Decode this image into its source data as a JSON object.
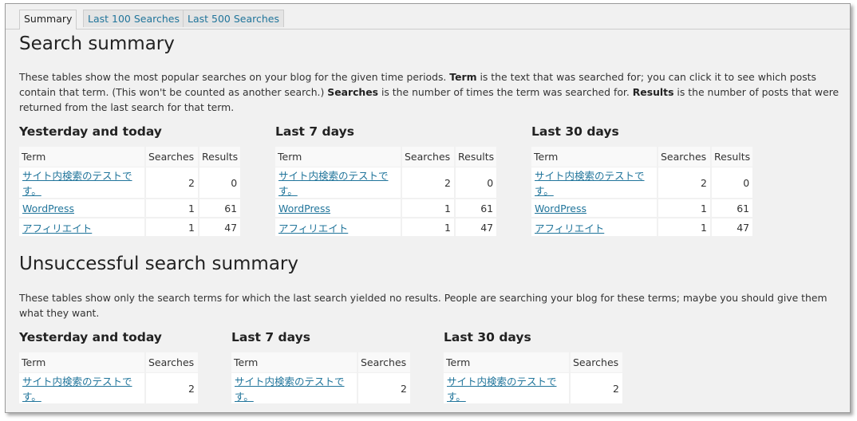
{
  "tabs": [
    "Summary",
    "Last 100 Searches",
    "Last 500 Searches"
  ],
  "summary": {
    "title": "Search summary",
    "desc": {
      "p1": "These tables show the most popular searches on your blog for the given time periods. ",
      "b1": "Term",
      "p2": " is the text that was searched for; you can click it to see which posts contain that term. (This won't be counted as another search.) ",
      "b2": "Searches",
      "p3": " is the number of times the term was searched for. ",
      "b3": "Results",
      "p4": " is the number of posts that were returned from the last search for that term."
    },
    "headers": {
      "term": "Term",
      "searches": "Searches",
      "results": "Results"
    },
    "periods": [
      {
        "title": "Yesterday and today",
        "rows": [
          {
            "term": "サイト内検索のテストです。",
            "searches": "2",
            "results": "0"
          },
          {
            "term": "WordPress",
            "searches": "1",
            "results": "61"
          },
          {
            "term": "アフィリエイト",
            "searches": "1",
            "results": "47"
          }
        ]
      },
      {
        "title": "Last 7 days",
        "rows": [
          {
            "term": "サイト内検索のテストです。",
            "searches": "2",
            "results": "0"
          },
          {
            "term": "WordPress",
            "searches": "1",
            "results": "61"
          },
          {
            "term": "アフィリエイト",
            "searches": "1",
            "results": "47"
          }
        ]
      },
      {
        "title": "Last 30 days",
        "rows": [
          {
            "term": "サイト内検索のテストです。",
            "searches": "2",
            "results": "0"
          },
          {
            "term": "WordPress",
            "searches": "1",
            "results": "61"
          },
          {
            "term": "アフィリエイト",
            "searches": "1",
            "results": "47"
          }
        ]
      }
    ]
  },
  "unsuccessful": {
    "title": "Unsuccessful search summary",
    "desc": "These tables show only the search terms for which the last search yielded no results. People are searching your blog for these terms; maybe you should give them what they want.",
    "headers": {
      "term": "Term",
      "searches": "Searches"
    },
    "periods": [
      {
        "title": "Yesterday and today",
        "rows": [
          {
            "term": "サイト内検索のテストです。",
            "searches": "2"
          }
        ]
      },
      {
        "title": "Last 7 days",
        "rows": [
          {
            "term": "サイト内検索のテストです。",
            "searches": "2"
          }
        ]
      },
      {
        "title": "Last 30 days",
        "rows": [
          {
            "term": "サイト内検索のテストです。",
            "searches": "2"
          }
        ]
      }
    ]
  }
}
